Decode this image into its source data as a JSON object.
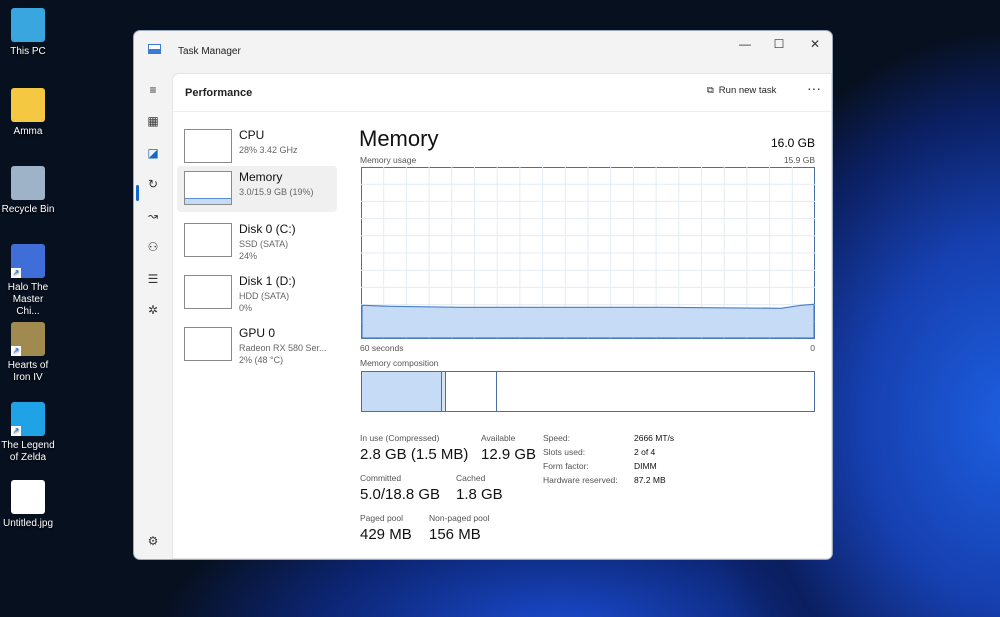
{
  "desktop": [
    {
      "label": "This PC",
      "color": "#3aa6e0"
    },
    {
      "label": "Amma",
      "color": "#f5c842"
    },
    {
      "label": "Recycle Bin",
      "color": "#9fb3c8"
    },
    {
      "label": "Halo The Master Chi...",
      "color": "#3f6ed8"
    },
    {
      "label": "Hearts of Iron IV",
      "color": "#a08a50"
    },
    {
      "label": "The Legend of Zelda",
      "color": "#1fa3e6"
    },
    {
      "label": "Untitled.jpg",
      "color": "#ffffff"
    }
  ],
  "window": {
    "title": "Task Manager",
    "minimize": "—",
    "maximize": "☐",
    "close": "✕"
  },
  "header": {
    "title": "Performance",
    "run_new_task": "Run new task",
    "more": "···"
  },
  "nav": [
    "≡",
    "▦",
    "◪",
    "↻",
    "↝",
    "⚇",
    "☰",
    "✲",
    "⚙"
  ],
  "devices": [
    {
      "name": "CPU",
      "line1": "28% 3.42 GHz",
      "line2": ""
    },
    {
      "name": "Memory",
      "line1": "3.0/15.9 GB (19%)",
      "line2": ""
    },
    {
      "name": "Disk 0 (C:)",
      "line1": "SSD (SATA)",
      "line2": "24%"
    },
    {
      "name": "Disk 1 (D:)",
      "line1": "HDD (SATA)",
      "line2": "0%"
    },
    {
      "name": "GPU 0",
      "line1": "Radeon RX 580 Ser...",
      "line2": "2% (48 °C)"
    }
  ],
  "memory": {
    "title": "Memory",
    "total": "16.0 GB",
    "usage_label": "Memory usage",
    "usage_max": "15.9 GB",
    "time_left": "60 seconds",
    "time_right": "0",
    "composition_label": "Memory composition",
    "usage_fraction": 0.19,
    "composition": {
      "in_use": 2.8,
      "modified": 0.15,
      "standby": 1.8,
      "total": 15.9
    },
    "stats": {
      "in_use_label": "In use (Compressed)",
      "in_use": "2.8 GB (1.5 MB)",
      "available_label": "Available",
      "available": "12.9 GB",
      "committed_label": "Committed",
      "committed": "5.0/18.8 GB",
      "cached_label": "Cached",
      "cached": "1.8 GB",
      "paged_label": "Paged pool",
      "paged": "429 MB",
      "nonpaged_label": "Non-paged pool",
      "nonpaged": "156 MB"
    },
    "details": [
      {
        "k": "Speed:",
        "v": "2666 MT/s"
      },
      {
        "k": "Slots used:",
        "v": "2 of 4"
      },
      {
        "k": "Form factor:",
        "v": "DIMM"
      },
      {
        "k": "Hardware reserved:",
        "v": "87.2 MB"
      }
    ]
  }
}
